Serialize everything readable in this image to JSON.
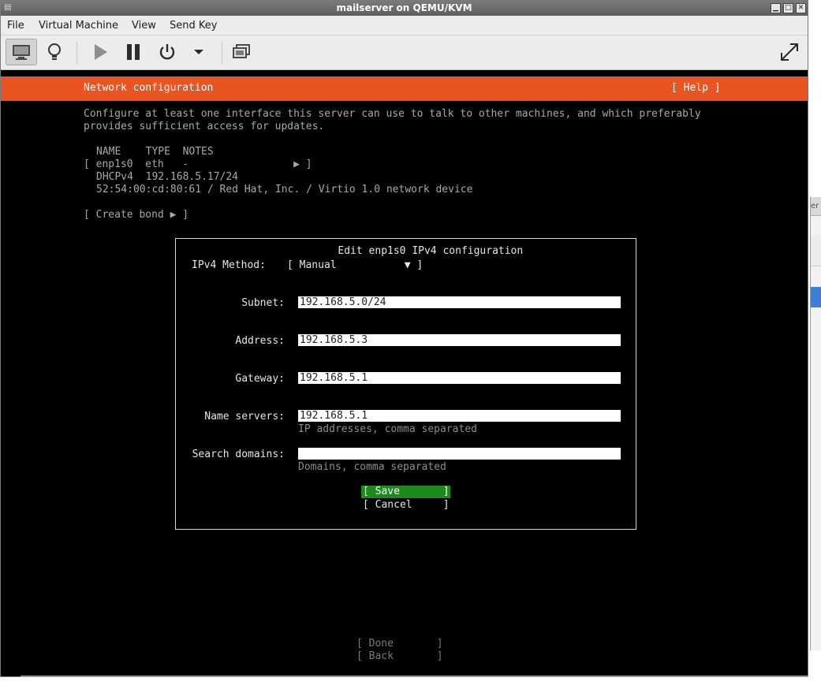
{
  "window": {
    "title": "mailserver on QEMU/KVM",
    "controls": {
      "minimize": "▁",
      "maximize": "□",
      "close": "✕"
    }
  },
  "peek_window": {
    "title_fragment": "er"
  },
  "menubar": [
    "File",
    "Virtual Machine",
    "View",
    "Send Key"
  ],
  "toolbar": {
    "icons": [
      "monitor-icon",
      "lightbulb-icon",
      "play-icon",
      "pause-icon",
      "power-icon",
      "chevron-down-icon",
      "screenshot-icon",
      "fullscreen-icon"
    ]
  },
  "installer": {
    "header_title": "Network configuration",
    "help": "[ Help ]",
    "description_line1": "Configure at least one interface this server can use to talk to other machines, and which preferably",
    "description_line2": "provides sufficient access for updates.",
    "table_header": "NAME    TYPE  NOTES",
    "iface_row": "[ enp1s0  eth   -                 ▶ ]",
    "iface_dhcp": "DHCPv4  192.168.5.17/24",
    "iface_hw": "52:54:00:cd:80:61 / Red Hat, Inc. / Virtio 1.0 network device",
    "create_bond": "[ Create bond ▶ ]",
    "done": "[ Done       ]",
    "back": "[ Back       ]"
  },
  "dialog": {
    "title": "Edit enp1s0 IPv4 configuration",
    "method_label": "IPv4 Method:",
    "method_value": "[ Manual           ▼ ]",
    "subnet_label": "Subnet:",
    "subnet_value": "192.168.5.0/24",
    "address_label": "Address:",
    "address_value": "192.168.5.3",
    "gateway_label": "Gateway:",
    "gateway_value": "192.168.5.1",
    "nameservers_label": "Name servers:",
    "nameservers_value": "192.168.5.1",
    "nameservers_hint": "IP addresses, comma separated",
    "searchdomains_label": "Search domains:",
    "searchdomains_value": "",
    "searchdomains_hint": "Domains, comma separated",
    "save": "[ Save       ]",
    "cancel": "[ Cancel     ]"
  },
  "colors": {
    "header_orange": "#e95420",
    "save_green": "#1e8a1e",
    "terminal_bg": "#000000"
  }
}
